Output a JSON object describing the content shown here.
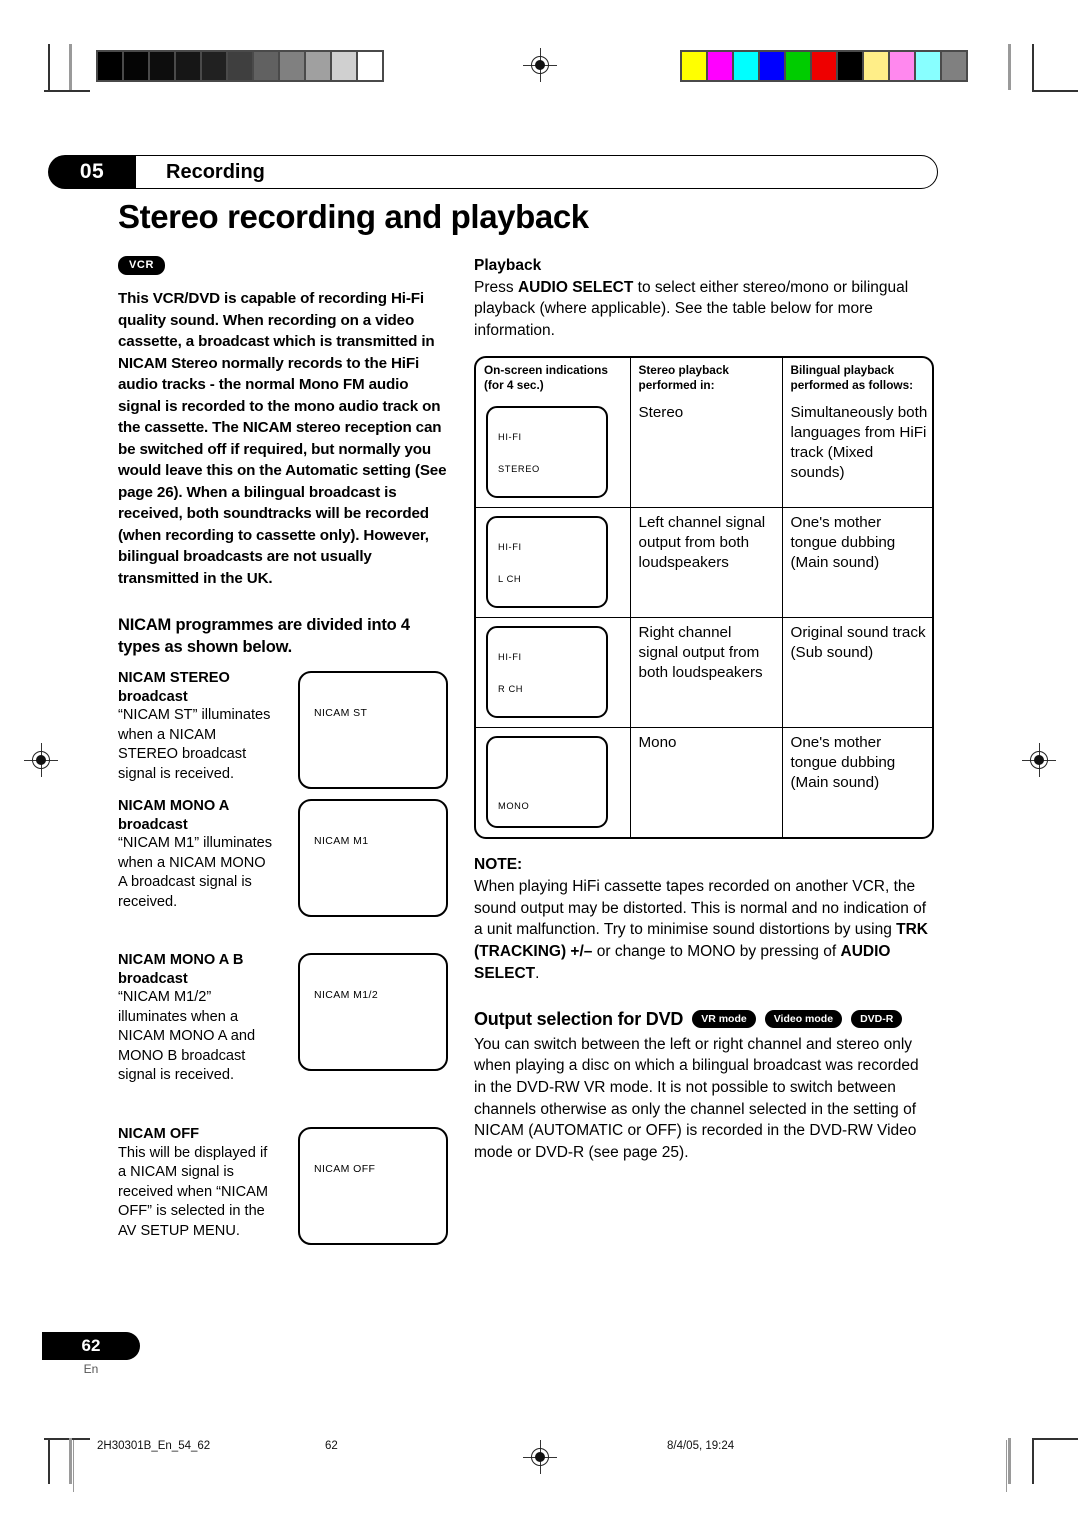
{
  "chapter": {
    "number": "05",
    "title": "Recording"
  },
  "doc_title": "Stereo recording and playback",
  "left_column": {
    "badge": "VCR",
    "intro": "This VCR/DVD is capable of recording Hi-Fi quality sound. When recording on a video cassette, a broadcast which is transmitted in NICAM Stereo normally records to the HiFi audio tracks - the normal Mono FM audio signal is recorded to the mono audio track on the cassette. The NICAM stereo reception can be switched off if required, but normally you would leave this on the Automatic setting (See page 26). When a bilingual broadcast is received, both soundtracks will be recorded (when recording to cassette only). However, bilingual broadcasts are not usually transmitted in the UK.",
    "subheading": "NICAM programmes are divided into 4 types as shown below.",
    "items": [
      {
        "title": "NICAM STEREO broadcast",
        "desc": "“NICAM ST” illuminates when a NICAM STEREO broadcast signal is received.",
        "osd": "NICAM ST"
      },
      {
        "title": "NICAM MONO A broadcast",
        "desc": "“NICAM M1” illuminates when a NICAM MONO A broadcast signal is received.",
        "osd": "NICAM M1"
      },
      {
        "title": "NICAM MONO A B broadcast",
        "desc": "“NICAM M1/2” illuminates when a NICAM MONO A and MONO B broadcast signal is received.",
        "osd": "NICAM M1/2"
      },
      {
        "title": "NICAM OFF",
        "desc": "This will be displayed if a NICAM signal is received when “NICAM OFF” is selected in the AV SETUP MENU.",
        "osd": "NICAM OFF"
      }
    ]
  },
  "right_column": {
    "playback_heading": "Playback",
    "playback_text_1": "Press ",
    "playback_bold_1": "AUDIO SELECT",
    "playback_text_2": " to select either stereo/mono or bilingual playback (where applicable). See the table below for more information.",
    "table": {
      "headers": [
        "On-screen indications (for 4 sec.)",
        "Stereo playback performed in:",
        "Bilingual playback performed as follows:"
      ],
      "rows": [
        {
          "osd_lines": [
            "HI-FI",
            "STEREO"
          ],
          "stereo": "Stereo",
          "bilingual": "Simultaneously both languages from HiFi track (Mixed sounds)"
        },
        {
          "osd_lines": [
            "HI-FI",
            "L CH"
          ],
          "stereo": "Left channel signal output from both loudspeakers",
          "bilingual": "One's mother tongue dubbing (Main sound)"
        },
        {
          "osd_lines": [
            "HI-FI",
            "R CH"
          ],
          "stereo": "Right channel signal output from both loudspeakers",
          "bilingual": "Original sound track (Sub sound)"
        },
        {
          "osd_lines": [
            "MONO"
          ],
          "stereo": "Mono",
          "bilingual": "One's mother tongue dubbing (Main sound)"
        }
      ]
    },
    "note_heading": "NOTE:",
    "note_p1": "When playing HiFi cassette tapes recorded on another VCR, the sound output may be distorted. This is normal and no indication of a unit malfunction. Try to minimise sound distortions by using ",
    "note_b1": "TRK (TRACKING) +/–",
    "note_p2": " or change to MONO by pressing of ",
    "note_b2": "AUDIO SELECT",
    "note_p3": ".",
    "dvd_heading": "Output selection for DVD",
    "dvd_tags": [
      "VR mode",
      "Video mode",
      "DVD-R"
    ],
    "dvd_body": "You can switch between the left or right channel and stereo only when playing a disc on which a bilingual broadcast was recorded in the DVD-RW VR mode. It is not possible to switch between channels otherwise as only the channel selected in the setting of NICAM (AUTOMATIC or OFF) is recorded in the DVD-RW Video mode or DVD-R (see page 25)."
  },
  "page_footer": {
    "page_number": "62",
    "language": "En",
    "file_id": "2H30301B_En_54_62",
    "sheet_number": "62",
    "timestamp": "8/4/05, 19:24"
  },
  "print_marks": {
    "gray_swatches": [
      "#000000",
      "#050505",
      "#0d0d0d",
      "#161616",
      "#212121",
      "#3f3f3f",
      "#616161",
      "#808080",
      "#a0a0a0",
      "#d0d0d0",
      "#ffffff"
    ],
    "color_swatches": [
      "#ffff00",
      "#ff00ff",
      "#00ffff",
      "#0000ff",
      "#00cc00",
      "#ee0000",
      "#000000",
      "#ffee88",
      "#ff88ee",
      "#88ffff",
      "#808080"
    ]
  }
}
